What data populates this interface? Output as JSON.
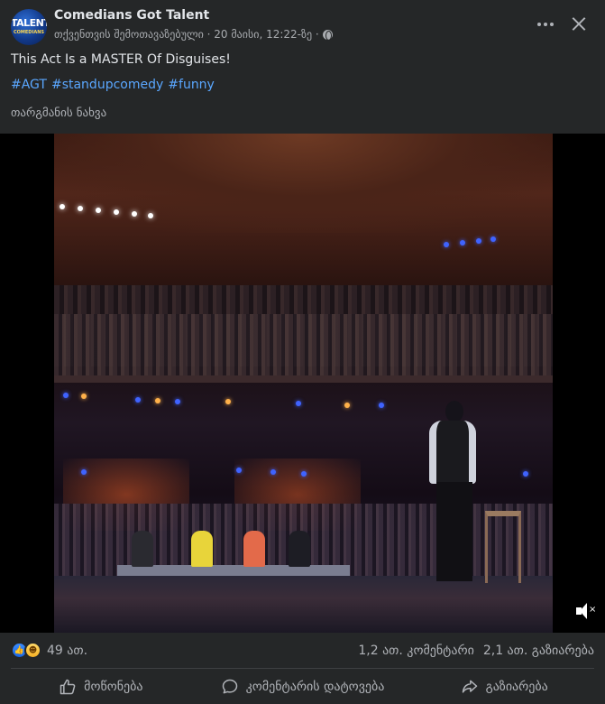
{
  "post": {
    "page_name": "Comedians Got Talent",
    "meta_text": "თქვენთვის შემოთავაზებული · 20 მაისი, 12:22-ზე ·",
    "avatar_logo_top": "TALENT",
    "avatar_logo_sub": "COMEDIANS",
    "text": "This Act Is a MASTER Of Disguises!",
    "hashtags": [
      "#AGT",
      "#standupcomedy",
      "#funny"
    ],
    "translate_label": "თარგმანის ნახვა"
  },
  "video": {
    "mute_icon": "speaker-muted-icon",
    "muted_mark": "×"
  },
  "engagement": {
    "reaction_count": "49 ათ.",
    "comments": "1,2 ათ. კომენტარი",
    "shares": "2,1 ათ. გაზიარება"
  },
  "actions": {
    "like": "მოწონება",
    "comment": "კომენტარის დატოვება",
    "share": "გაზიარება"
  },
  "colors": {
    "background": "#252728",
    "link": "#5aa7ff",
    "text_secondary": "#b0b3b8",
    "like_blue": "#1865e3"
  }
}
